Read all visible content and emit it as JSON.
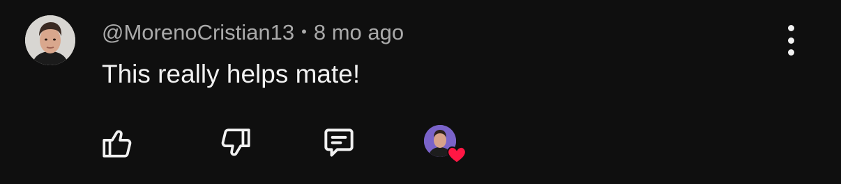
{
  "comment": {
    "author": "@MorenoCristian13",
    "separator": "•",
    "timestamp": "8 mo ago",
    "text": "This really helps mate!"
  },
  "actions": {
    "like_icon": "thumbs-up-icon",
    "dislike_icon": "thumbs-down-icon",
    "reply_icon": "comment-icon",
    "more_icon": "more-vertical-icon",
    "creator_heart_icon": "heart-icon"
  },
  "colors": {
    "background": "#0f0f0f",
    "text_primary": "#f1f1f1",
    "text_secondary": "#aaaaaa",
    "heart": "#ff1744",
    "creator_avatar_bg": "#7a63c9"
  }
}
